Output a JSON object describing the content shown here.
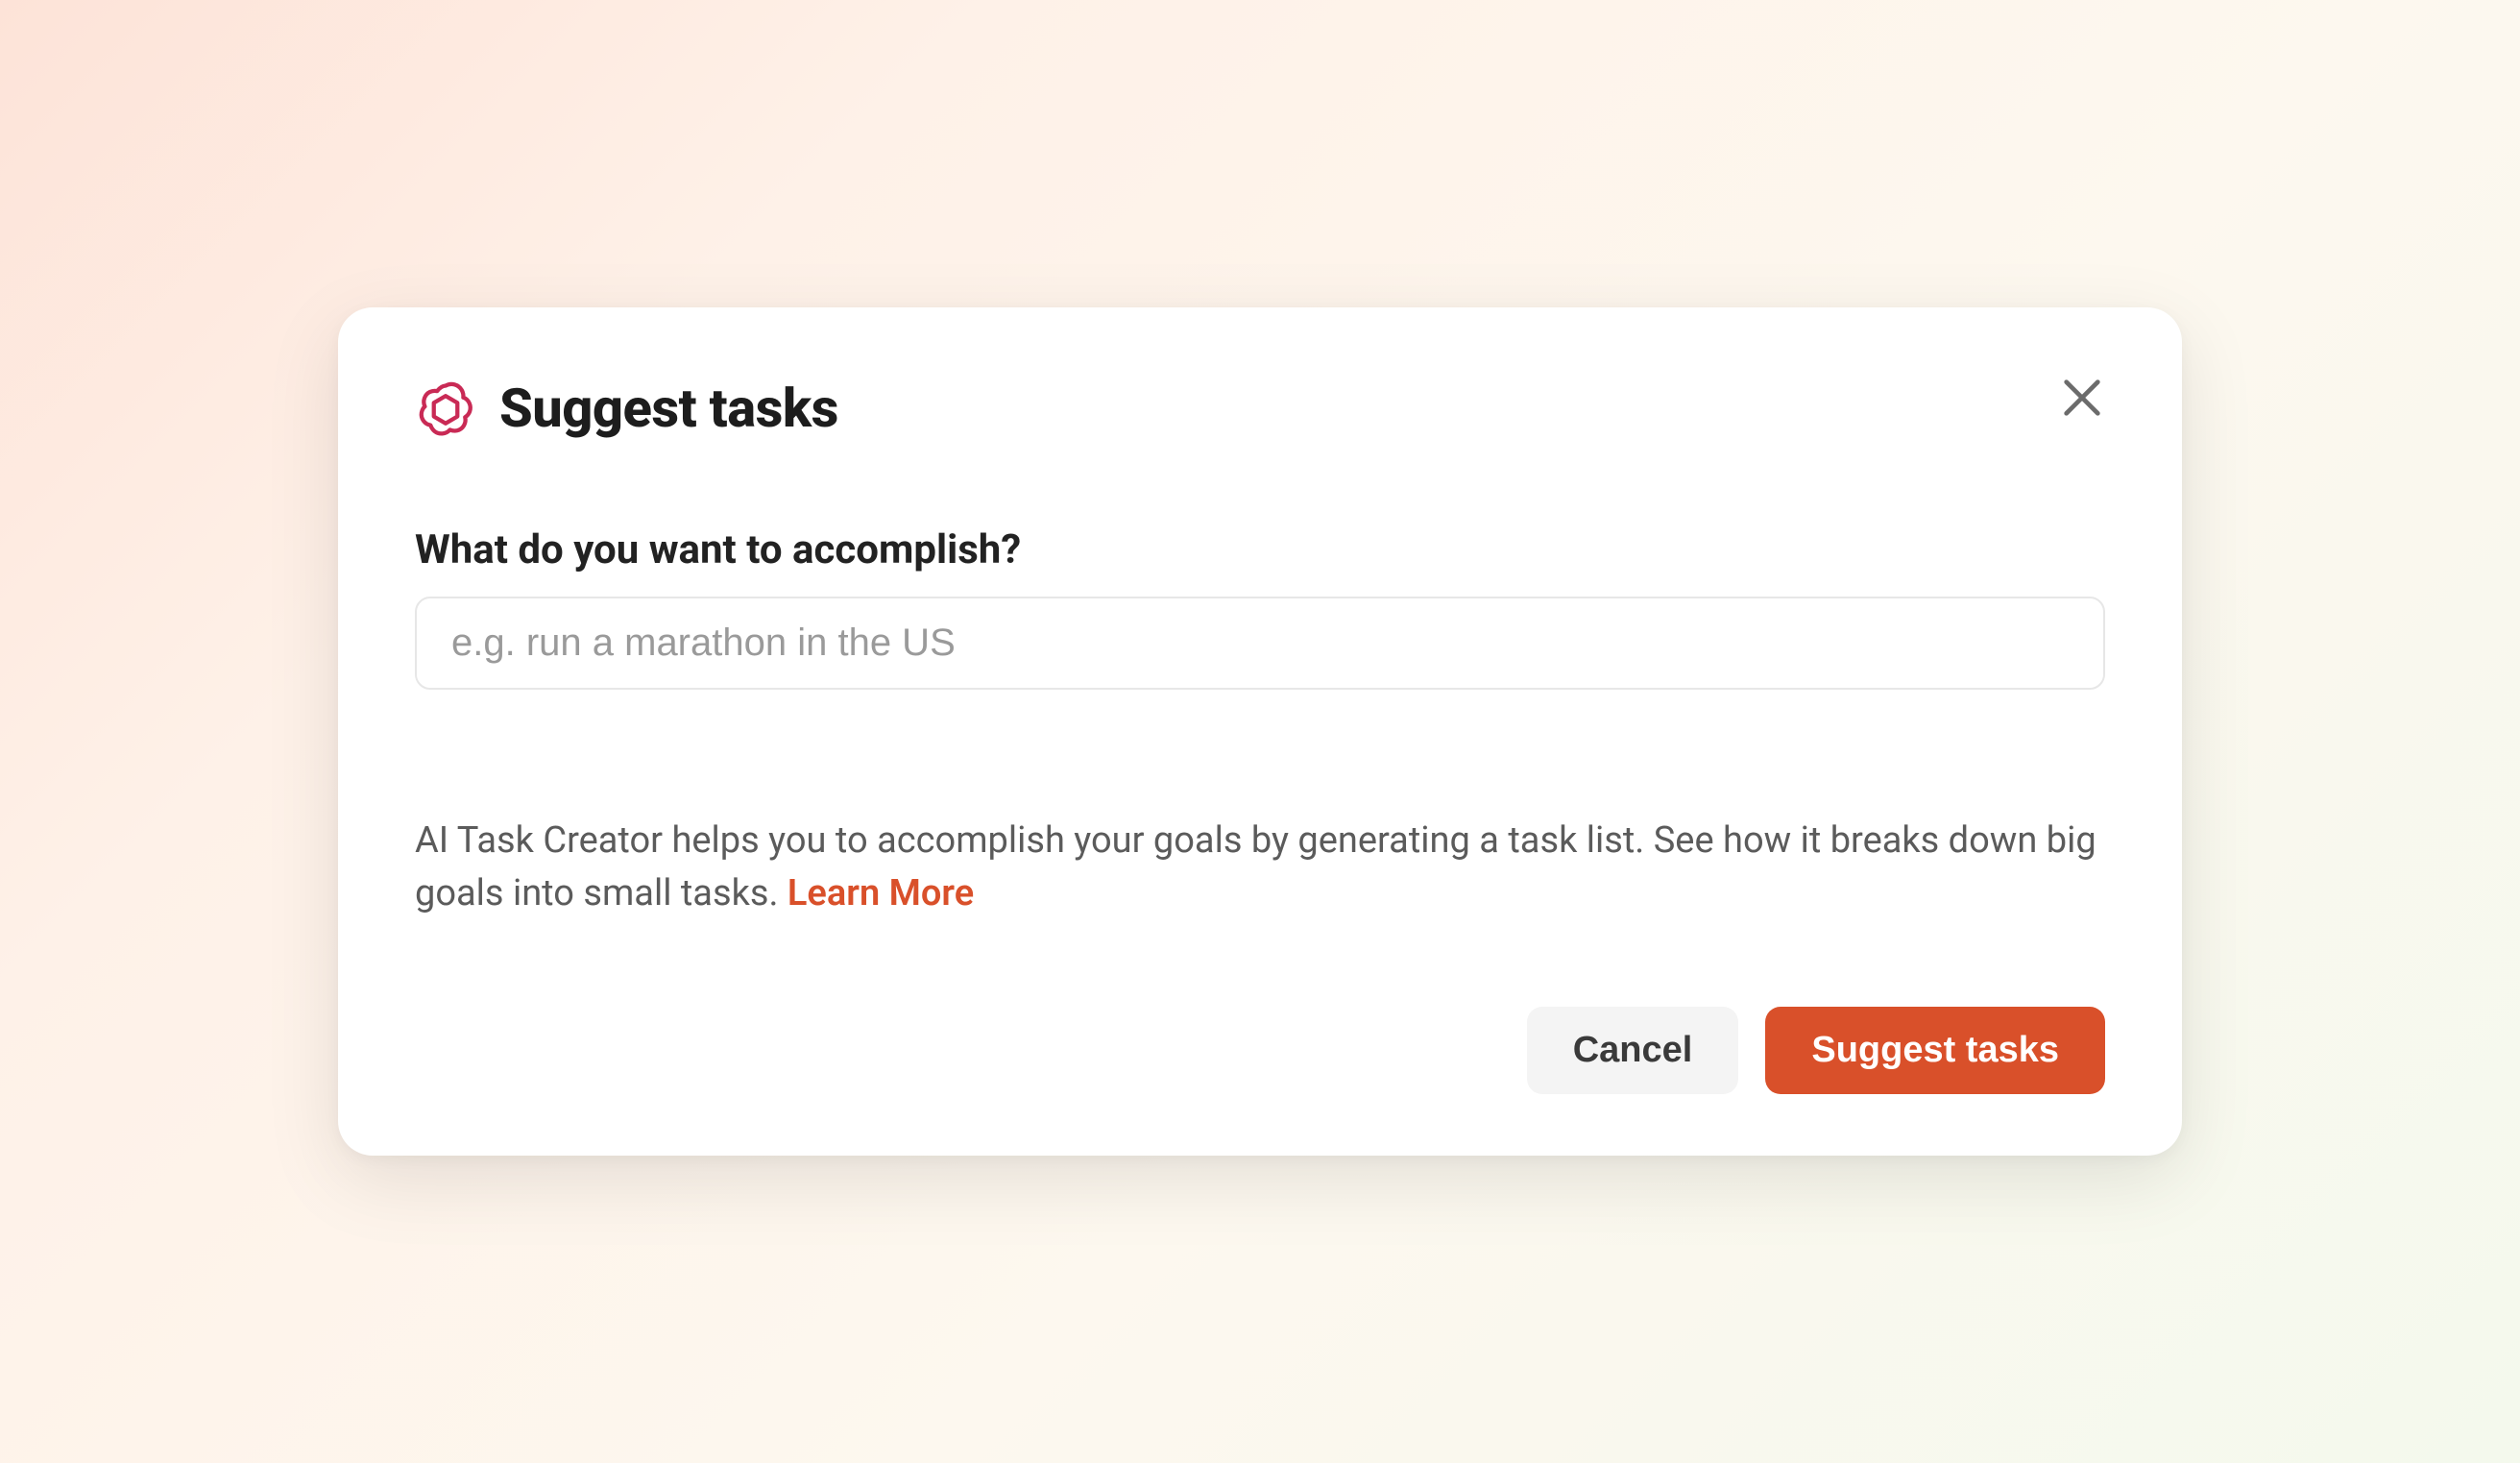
{
  "modal": {
    "title": "Suggest tasks",
    "icon": "openai-logo",
    "close_label": "Close"
  },
  "form": {
    "prompt_label": "What do you want to accomplish?",
    "goal_placeholder": "e.g. run a marathon in the US",
    "goal_value": ""
  },
  "helper": {
    "text": "AI Task Creator helps you to accomplish your goals by generating a task list. See how it breaks down big goals into small tasks. ",
    "learn_more_label": "Learn More"
  },
  "footer": {
    "cancel_label": "Cancel",
    "submit_label": "Suggest tasks"
  },
  "colors": {
    "accent": "#d9502a",
    "logo": "#c92a55"
  }
}
